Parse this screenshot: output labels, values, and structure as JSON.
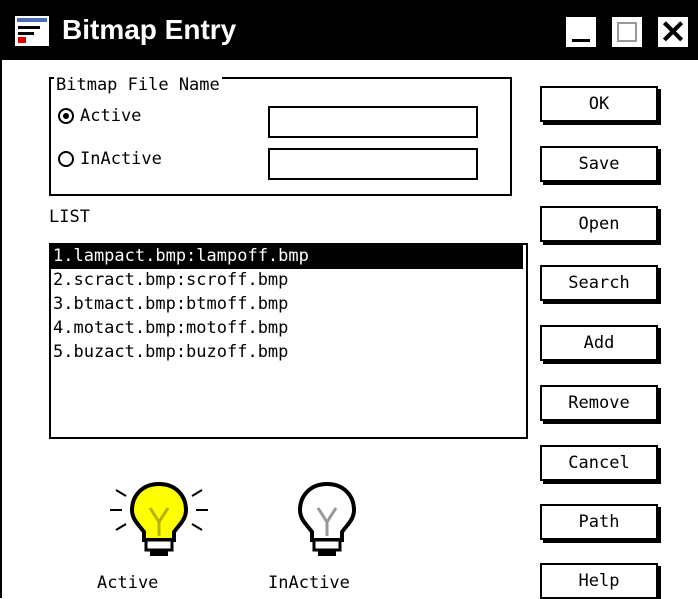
{
  "window": {
    "title": "Bitmap Entry"
  },
  "titlebar": {
    "minimize_icon": "minimize-icon",
    "maximize_icon": "maximize-icon",
    "close_icon": "close-icon",
    "close_glyph": "✕"
  },
  "bitmap_file_name": {
    "label": "Bitmap File Name",
    "options": [
      {
        "label": "Active",
        "checked": true,
        "value": ""
      },
      {
        "label": "InActive",
        "checked": false,
        "value": ""
      }
    ]
  },
  "list": {
    "label": "LIST",
    "items": [
      "1.lampact.bmp:lampoff.bmp",
      "2.scract.bmp:scroff.bmp",
      "3.btmact.bmp:btmoff.bmp",
      "4.motact.bmp:motoff.bmp",
      "5.buzact.bmp:buzoff.bmp"
    ],
    "selected_index": 0
  },
  "buttons": {
    "ok": "OK",
    "save": "Save",
    "open": "Open",
    "search": "Search",
    "add": "Add",
    "remove": "Remove",
    "cancel": "Cancel",
    "path": "Path",
    "help": "Help"
  },
  "preview": {
    "active_label": "Active",
    "inactive_label": "InActive",
    "active_icon": "lightbulb-on-icon",
    "inactive_icon": "lightbulb-off-icon"
  },
  "colors": {
    "bulb_on": "#ffff00",
    "titlebar": "#000000"
  }
}
